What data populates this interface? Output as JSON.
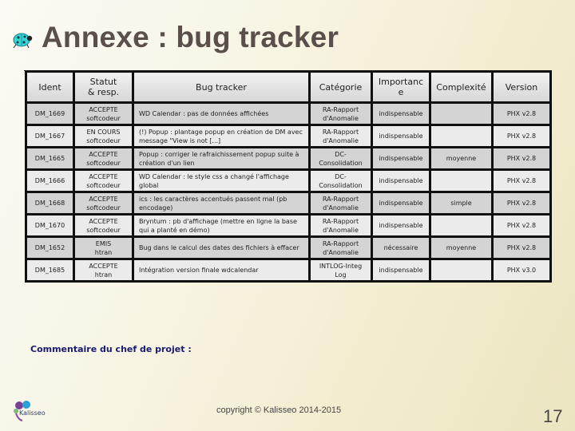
{
  "slide": {
    "title": "Annexe : bug tracker",
    "title_icon": "ladybug-icon",
    "comment_label": "Commentaire du chef de projet :",
    "logo_text": "Kalisseo",
    "copyright": "copyright © Kalisseo 2014-2015",
    "page_number": "17"
  },
  "table": {
    "headers": [
      "Ident",
      "Statut\n& resp.",
      "Bug tracker",
      "Catégorie",
      "Importanc\ne",
      "Complexité",
      "Version"
    ],
    "rows": [
      {
        "ident": "DM_1669",
        "status": "ACCEPTE",
        "resp": "softcodeur",
        "bug": "WD Calendar : pas de données affichées",
        "category": "RA-Rapport d'Anomalie",
        "importance": "indispensable",
        "complexity": "",
        "version": "PHX v2.8"
      },
      {
        "ident": "DM_1667",
        "status": "EN COURS",
        "resp": "softcodeur",
        "bug": "(!) Popup : plantage popup en création de DM avec message \"View is not [...]",
        "category": "RA-Rapport d'Anomalie",
        "importance": "indispensable",
        "complexity": "",
        "version": "PHX v2.8"
      },
      {
        "ident": "DM_1665",
        "status": "ACCEPTE",
        "resp": "softcodeur",
        "bug": "Popup : corriger le rafraichissement popup suite à création d'un lien",
        "category": "DC-Consolidation",
        "importance": "indispensable",
        "complexity": "moyenne",
        "version": "PHX v2.8"
      },
      {
        "ident": "DM_1666",
        "status": "ACCEPTE",
        "resp": "softcodeur",
        "bug": "WD Calendar : le style css a changé l'affichage global",
        "category": "DC-Consolidation",
        "importance": "indispensable",
        "complexity": "",
        "version": "PHX v2.8"
      },
      {
        "ident": "DM_1668",
        "status": "ACCEPTE",
        "resp": "softcodeur",
        "bug": "ics : les caractères accentués passent mal (pb encodage)",
        "category": "RA-Rapport d'Anomalie",
        "importance": "indispensable",
        "complexity": "simple",
        "version": "PHX v2.8"
      },
      {
        "ident": "DM_1670",
        "status": "ACCEPTE",
        "resp": "softcodeur",
        "bug": "Bryntum : pb d'affichage (mettre en ligne la base qui a planté en démo)",
        "category": "RA-Rapport d'Anomalie",
        "importance": "indispensable",
        "complexity": "",
        "version": "PHX v2.8"
      },
      {
        "ident": "DM_1652",
        "status": "EMIS",
        "resp": "htran",
        "bug": "Bug dans le calcul des dates des fichiers à effacer",
        "category": "RA-Rapport d'Anomalie",
        "importance": "nécessaire",
        "complexity": "moyenne",
        "version": "PHX v2.8"
      },
      {
        "ident": "DM_1685",
        "status": "ACCEPTE",
        "resp": "htran",
        "bug": "Intégration version finale wdcalendar",
        "category": "INTLOG-Integ Log",
        "importance": "indispensable",
        "complexity": "",
        "version": "PHX v3.0"
      }
    ]
  }
}
